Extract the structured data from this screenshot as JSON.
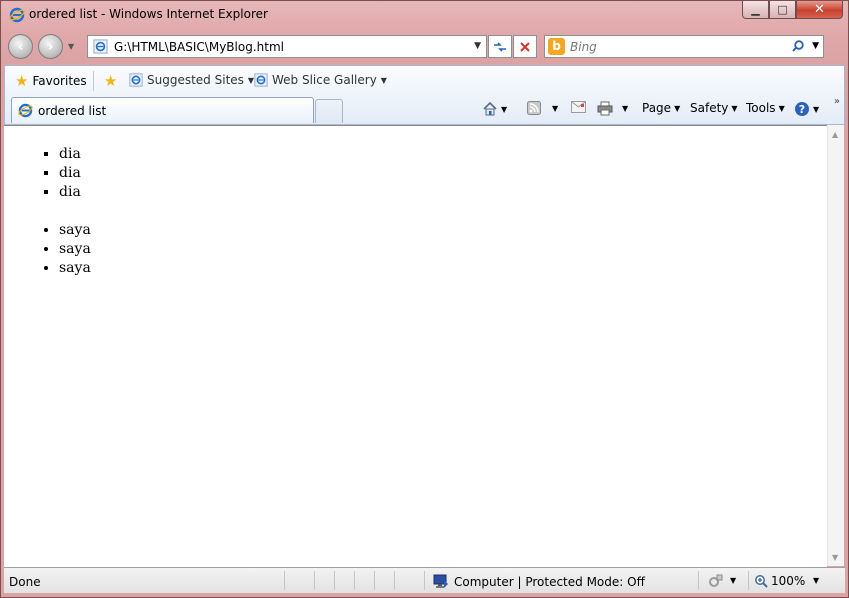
{
  "window": {
    "title": "ordered list - Windows Internet Explorer",
    "minimize_glyph": "▁",
    "maximize_glyph": "□",
    "close_glyph": "✕"
  },
  "address_bar": {
    "url": "G:\\HTML\\BASIC\\MyBlog.html"
  },
  "search": {
    "placeholder": "Bing",
    "engine_logo": "b"
  },
  "favorites_bar": {
    "favorites_label": "Favorites",
    "items": [
      {
        "label": "Suggested Sites"
      },
      {
        "label": "Web Slice Gallery"
      }
    ]
  },
  "tab": {
    "title": "ordered list"
  },
  "command_bar": {
    "page_label": "Page",
    "safety_label": "Safety",
    "tools_label": "Tools",
    "more_label": "»"
  },
  "content": {
    "square_list": [
      "dia",
      "dia",
      "dia"
    ],
    "disc_list": [
      "saya",
      "saya",
      "saya"
    ]
  },
  "status_bar": {
    "status_text": "Done",
    "zone_text": "Computer | Protected Mode: Off",
    "zoom_text": "100%"
  },
  "colors": {
    "frame": "#dca3a5",
    "close_button": "#c8402f",
    "toolbar": "#e4ecf7"
  }
}
